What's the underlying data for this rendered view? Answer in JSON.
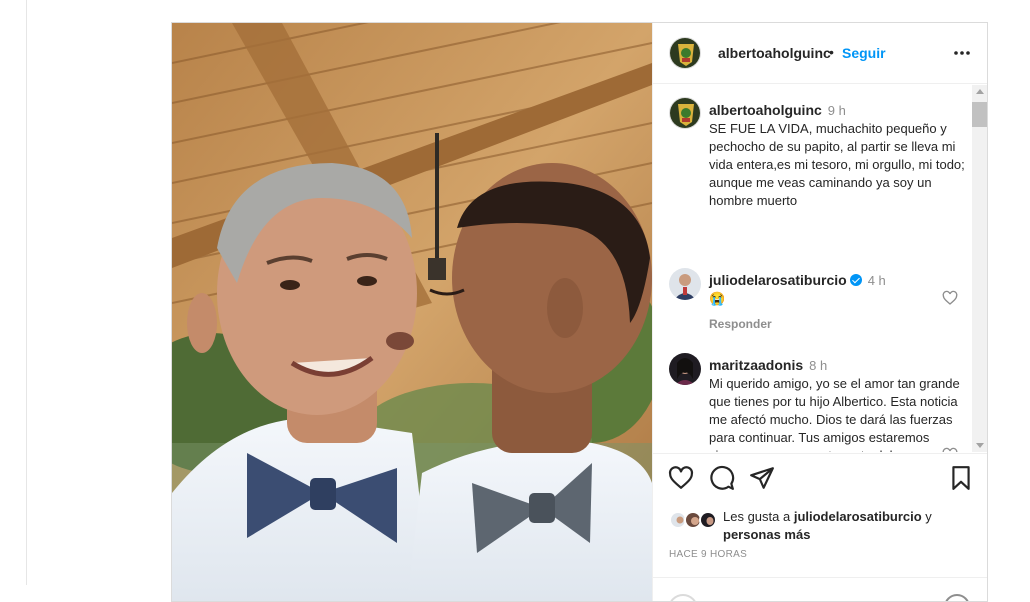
{
  "post": {
    "author": {
      "username": "albertoaholguinc",
      "separator": "•",
      "follow_label": "Seguir"
    },
    "caption": {
      "username": "albertoaholguinc",
      "time": "9 h",
      "text": "SE FUE LA VIDA, muchachito pequeño y pechocho de su papito, al partir se lleva mi vida entera,es mi tesoro, mi orgullo, mi todo; aunque me veas caminando ya soy un hombre muerto"
    },
    "comments": [
      {
        "username": "julio­delarosatiburcio",
        "verified": true,
        "time": "4 h",
        "text": "😭",
        "reply_label": "Responder"
      },
      {
        "username": "maritzaadonis",
        "verified": false,
        "time": "8 h",
        "text": "Mi querido amigo, yo se el amor tan grande que tienes por tu hijo Albertico. Esta noticia me afectó mucho. Dios te dará las fuerzas para continuar. Tus amigos estaremos siempre para apoyarte en tu dolor."
      }
    ],
    "likes": {
      "prefix": "Les gusta a ",
      "user": "juliodelarosatiburcio",
      "suffix": " y",
      "more": "personas más"
    },
    "time_ago": "HACE 9 HORAS",
    "icons": {
      "like": "heart-outline-icon",
      "comment": "speech-bubble-icon",
      "share": "paper-plane-icon",
      "save": "bookmark-icon",
      "options": "more-horizontal-icon"
    },
    "colors": {
      "follow": "#0095f6",
      "verified": "#0095f6",
      "muted": "#8e8e8e"
    }
  }
}
